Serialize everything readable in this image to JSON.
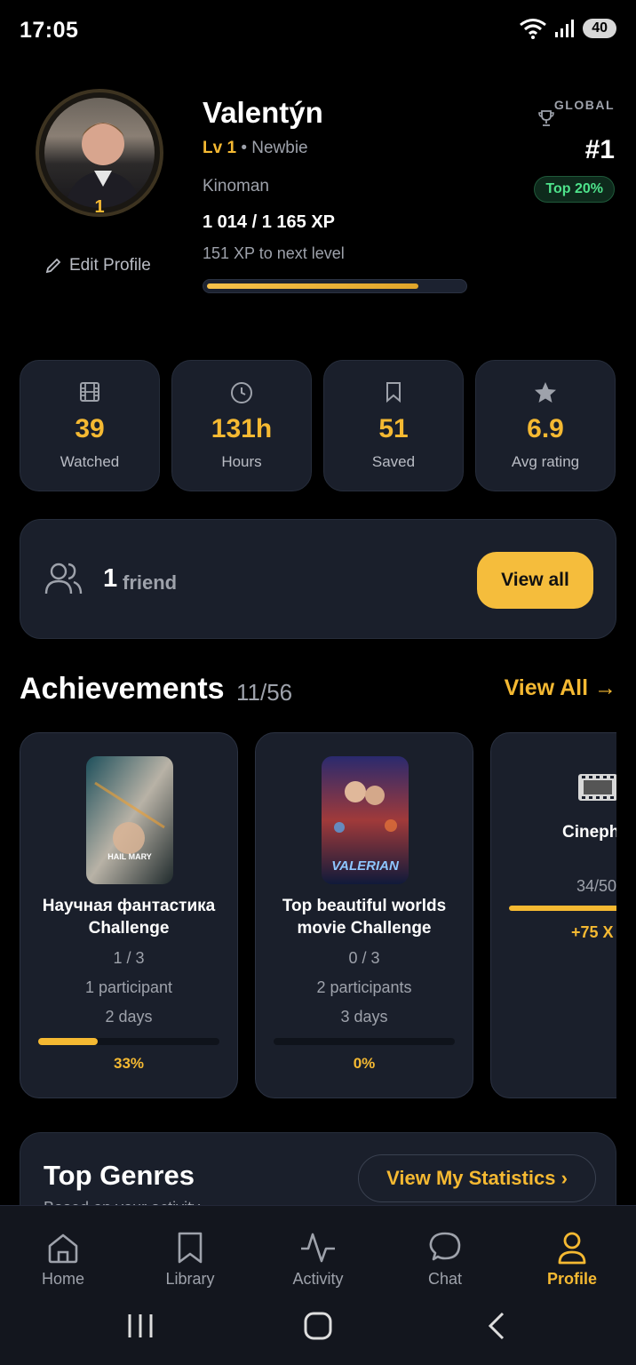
{
  "status": {
    "time": "17:05",
    "battery": "40"
  },
  "profile": {
    "name": "Valentýn",
    "level": "Lv 1",
    "level_title": "• Newbie",
    "title": "Kinoman",
    "avatar_level": "1",
    "xp": "1 014 / 1 165 XP",
    "xp_next": "151 XP to next level",
    "xp_progress": 0.87,
    "edit_label": "Edit Profile"
  },
  "ranking": {
    "label": "GLOBAL",
    "rank": "#1",
    "percentile": "Top 20%"
  },
  "stats": [
    {
      "icon": "film-icon",
      "value": "39",
      "label": "Watched"
    },
    {
      "icon": "clock-icon",
      "value": "131h",
      "label": "Hours"
    },
    {
      "icon": "bookmark-icon",
      "value": "51",
      "label": "Saved"
    },
    {
      "icon": "star-icon",
      "value": "6.9",
      "label": "Avg rating"
    }
  ],
  "friends": {
    "count": "1",
    "label": "friend",
    "button": "View all"
  },
  "achievements": {
    "title": "Achievements",
    "count": "11/56",
    "view_all": "View All →",
    "items": [
      {
        "name": "Научная фантастика Challenge",
        "progress": "1 / 3",
        "participants": "1 participant",
        "days": "2 days",
        "percent": "33%",
        "fill": 0.33,
        "poster_text": "HAIL MARY"
      },
      {
        "name": "Top beautiful worlds movie Challenge",
        "progress": "0 / 3",
        "participants": "2 participants",
        "days": "3 days",
        "percent": "0%",
        "fill": 0,
        "poster_text": "VALERIAN"
      },
      {
        "name": "Cineph",
        "progress": "34/50",
        "xp": "+75 X",
        "fill": 0.68
      }
    ]
  },
  "genres": {
    "title": "Top Genres",
    "subtitle": "Based on your activity",
    "button": "View My Statistics ›"
  },
  "nav": [
    {
      "icon": "home-icon",
      "label": "Home"
    },
    {
      "icon": "library-icon",
      "label": "Library"
    },
    {
      "icon": "activity-icon",
      "label": "Activity"
    },
    {
      "icon": "chat-icon",
      "label": "Chat"
    },
    {
      "icon": "profile-icon",
      "label": "Profile",
      "active": true
    }
  ],
  "colors": {
    "accent": "#f5b932",
    "card": "#1a1f2b",
    "background": "#000000",
    "success": "#4ee38b"
  }
}
